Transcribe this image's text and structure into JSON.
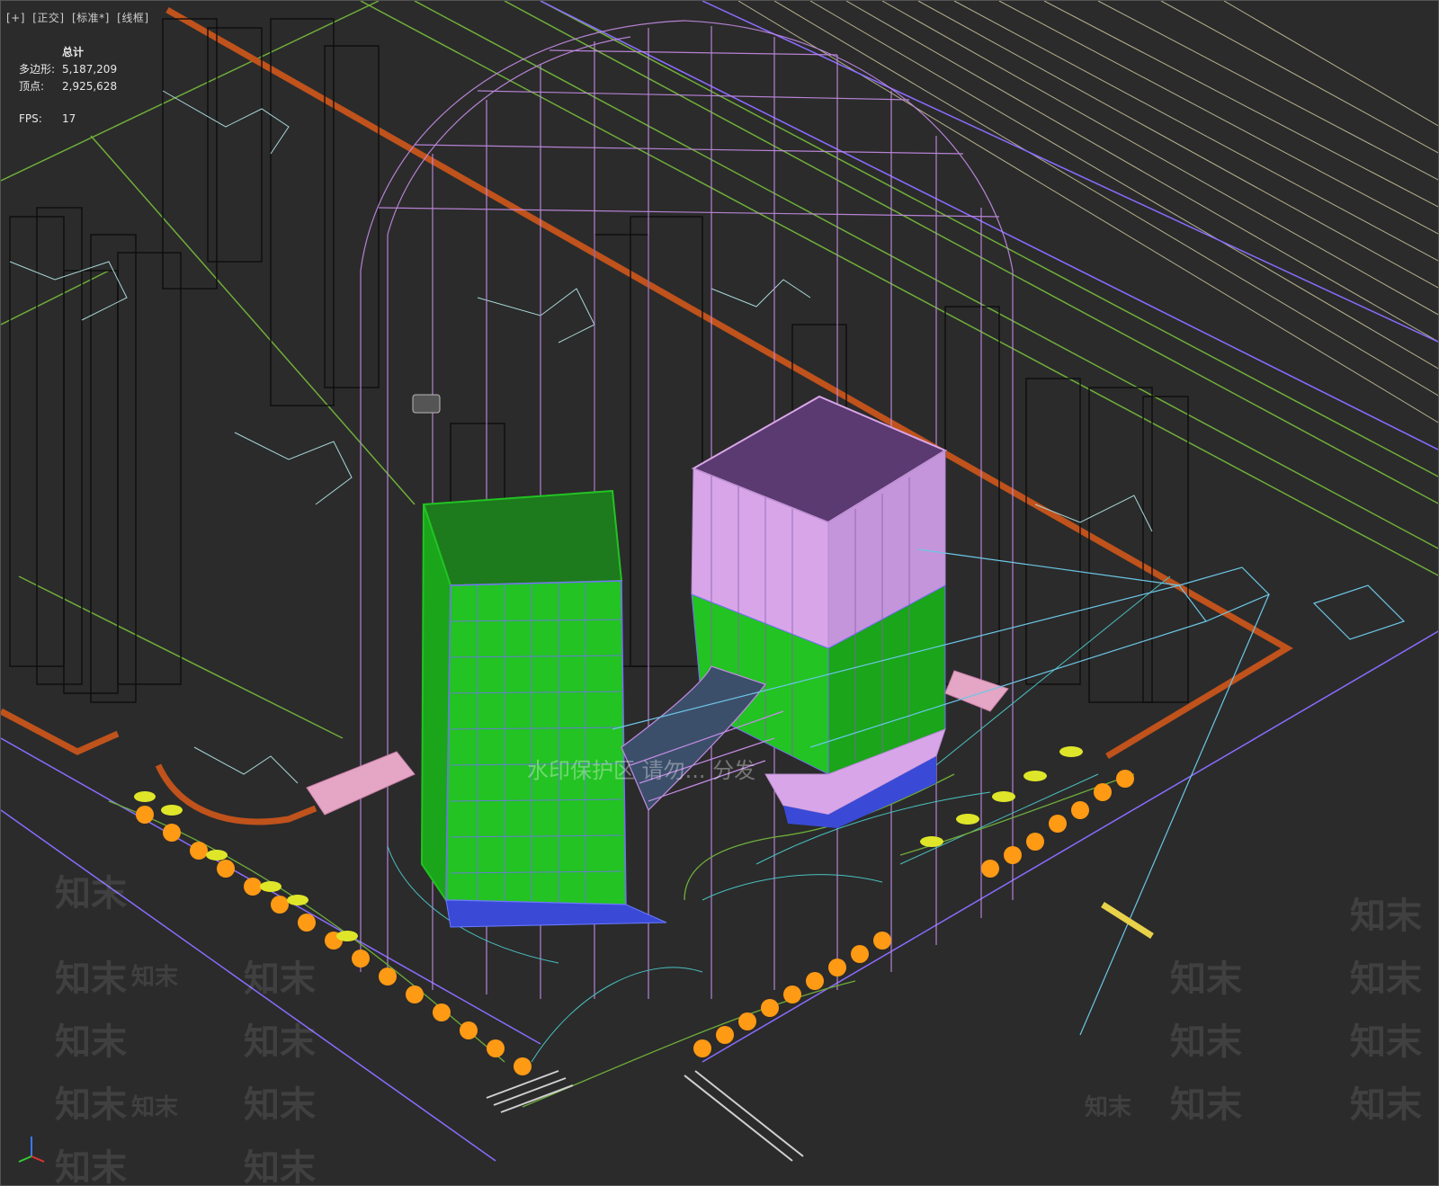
{
  "viewport": {
    "labels": [
      "[+]",
      "[正交]",
      "[标准*]",
      "[线框]"
    ]
  },
  "stats": {
    "title": "总计",
    "polygons_label": "多边形:",
    "polygons_value": "5,187,209",
    "vertices_label": "顶点:",
    "vertices_value": "2,925,628",
    "fps_label": "FPS:",
    "fps_value": "17"
  },
  "watermark": {
    "brand": "知末",
    "center_text": "水印保护区 请勿... 分发"
  },
  "colors": {
    "background": "#2b2b2b",
    "building_green": "#22c322",
    "building_pink": "#d8a6e8",
    "dome_wire": "#c58ce6",
    "road_orange": "#c0521c",
    "road_green": "#6fae3a",
    "road_purple": "#8a6cff",
    "tree_orange": "#ff9a14",
    "car_yellow": "#dfe62a",
    "cyan_wire": "#6cc6e6"
  },
  "icons": {
    "axis_gizmo": "xyz-axis-icon",
    "camera": "camera-icon"
  }
}
